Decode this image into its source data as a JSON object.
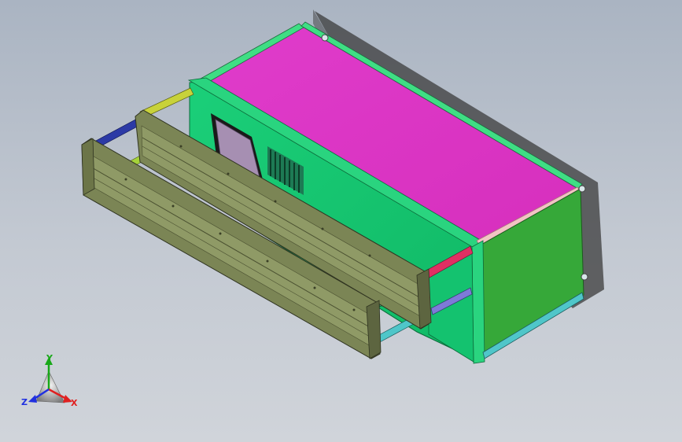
{
  "viewport": {
    "background_top": "#aab4c2",
    "background_bottom": "#d0d4da"
  },
  "model": {
    "colors": {
      "top_face": "#de35c4",
      "front_face": "#14c26f",
      "end_face": "#33a336",
      "rail_green": "#38d67a",
      "pink_strip": "#f2c4c4",
      "tray": "#7b8555",
      "tray_inner": "#8f9a66",
      "tray_dark": "#5d6540",
      "window": "#a68fb2",
      "bar_navy": "#2c3aa6",
      "bar_yellow": "#c8d23a",
      "bar_cyan": "#4fc6c9",
      "bar_red": "#e02f63",
      "bar_violet": "#7e7ad8",
      "bar_teal": "#34a57a"
    }
  },
  "triad": {
    "x_label": "X",
    "y_label": "Y",
    "z_label": "Z",
    "x_color": "#e02020",
    "y_color": "#18a818",
    "z_color": "#2030e0"
  }
}
